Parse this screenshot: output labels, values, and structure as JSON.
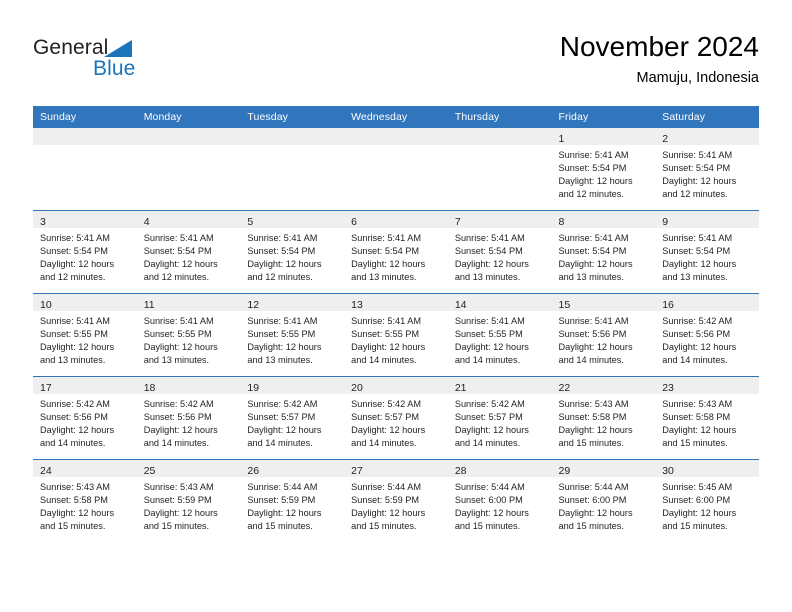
{
  "logo": {
    "word1": "General",
    "word2": "Blue",
    "triangle_color": "#1b75bb",
    "word1_color": "#231f20",
    "word2_color": "#1b75bb"
  },
  "header": {
    "title": "November 2024",
    "subtitle": "Mamuju, Indonesia"
  },
  "theme": {
    "header_blue": "#3175bc",
    "daynum_band": "#efefef",
    "text": "#231f20"
  },
  "weekdays": [
    "Sunday",
    "Monday",
    "Tuesday",
    "Wednesday",
    "Thursday",
    "Friday",
    "Saturday"
  ],
  "weeks": [
    [
      {
        "empty": true
      },
      {
        "empty": true
      },
      {
        "empty": true
      },
      {
        "empty": true
      },
      {
        "empty": true
      },
      {
        "day": "1",
        "l1": "Sunrise: 5:41 AM",
        "l2": "Sunset: 5:54 PM",
        "l3": "Daylight: 12 hours",
        "l4": "and 12 minutes."
      },
      {
        "day": "2",
        "l1": "Sunrise: 5:41 AM",
        "l2": "Sunset: 5:54 PM",
        "l3": "Daylight: 12 hours",
        "l4": "and 12 minutes."
      }
    ],
    [
      {
        "day": "3",
        "l1": "Sunrise: 5:41 AM",
        "l2": "Sunset: 5:54 PM",
        "l3": "Daylight: 12 hours",
        "l4": "and 12 minutes."
      },
      {
        "day": "4",
        "l1": "Sunrise: 5:41 AM",
        "l2": "Sunset: 5:54 PM",
        "l3": "Daylight: 12 hours",
        "l4": "and 12 minutes."
      },
      {
        "day": "5",
        "l1": "Sunrise: 5:41 AM",
        "l2": "Sunset: 5:54 PM",
        "l3": "Daylight: 12 hours",
        "l4": "and 12 minutes."
      },
      {
        "day": "6",
        "l1": "Sunrise: 5:41 AM",
        "l2": "Sunset: 5:54 PM",
        "l3": "Daylight: 12 hours",
        "l4": "and 13 minutes."
      },
      {
        "day": "7",
        "l1": "Sunrise: 5:41 AM",
        "l2": "Sunset: 5:54 PM",
        "l3": "Daylight: 12 hours",
        "l4": "and 13 minutes."
      },
      {
        "day": "8",
        "l1": "Sunrise: 5:41 AM",
        "l2": "Sunset: 5:54 PM",
        "l3": "Daylight: 12 hours",
        "l4": "and 13 minutes."
      },
      {
        "day": "9",
        "l1": "Sunrise: 5:41 AM",
        "l2": "Sunset: 5:54 PM",
        "l3": "Daylight: 12 hours",
        "l4": "and 13 minutes."
      }
    ],
    [
      {
        "day": "10",
        "l1": "Sunrise: 5:41 AM",
        "l2": "Sunset: 5:55 PM",
        "l3": "Daylight: 12 hours",
        "l4": "and 13 minutes."
      },
      {
        "day": "11",
        "l1": "Sunrise: 5:41 AM",
        "l2": "Sunset: 5:55 PM",
        "l3": "Daylight: 12 hours",
        "l4": "and 13 minutes."
      },
      {
        "day": "12",
        "l1": "Sunrise: 5:41 AM",
        "l2": "Sunset: 5:55 PM",
        "l3": "Daylight: 12 hours",
        "l4": "and 13 minutes."
      },
      {
        "day": "13",
        "l1": "Sunrise: 5:41 AM",
        "l2": "Sunset: 5:55 PM",
        "l3": "Daylight: 12 hours",
        "l4": "and 14 minutes."
      },
      {
        "day": "14",
        "l1": "Sunrise: 5:41 AM",
        "l2": "Sunset: 5:55 PM",
        "l3": "Daylight: 12 hours",
        "l4": "and 14 minutes."
      },
      {
        "day": "15",
        "l1": "Sunrise: 5:41 AM",
        "l2": "Sunset: 5:56 PM",
        "l3": "Daylight: 12 hours",
        "l4": "and 14 minutes."
      },
      {
        "day": "16",
        "l1": "Sunrise: 5:42 AM",
        "l2": "Sunset: 5:56 PM",
        "l3": "Daylight: 12 hours",
        "l4": "and 14 minutes."
      }
    ],
    [
      {
        "day": "17",
        "l1": "Sunrise: 5:42 AM",
        "l2": "Sunset: 5:56 PM",
        "l3": "Daylight: 12 hours",
        "l4": "and 14 minutes."
      },
      {
        "day": "18",
        "l1": "Sunrise: 5:42 AM",
        "l2": "Sunset: 5:56 PM",
        "l3": "Daylight: 12 hours",
        "l4": "and 14 minutes."
      },
      {
        "day": "19",
        "l1": "Sunrise: 5:42 AM",
        "l2": "Sunset: 5:57 PM",
        "l3": "Daylight: 12 hours",
        "l4": "and 14 minutes."
      },
      {
        "day": "20",
        "l1": "Sunrise: 5:42 AM",
        "l2": "Sunset: 5:57 PM",
        "l3": "Daylight: 12 hours",
        "l4": "and 14 minutes."
      },
      {
        "day": "21",
        "l1": "Sunrise: 5:42 AM",
        "l2": "Sunset: 5:57 PM",
        "l3": "Daylight: 12 hours",
        "l4": "and 14 minutes."
      },
      {
        "day": "22",
        "l1": "Sunrise: 5:43 AM",
        "l2": "Sunset: 5:58 PM",
        "l3": "Daylight: 12 hours",
        "l4": "and 15 minutes."
      },
      {
        "day": "23",
        "l1": "Sunrise: 5:43 AM",
        "l2": "Sunset: 5:58 PM",
        "l3": "Daylight: 12 hours",
        "l4": "and 15 minutes."
      }
    ],
    [
      {
        "day": "24",
        "l1": "Sunrise: 5:43 AM",
        "l2": "Sunset: 5:58 PM",
        "l3": "Daylight: 12 hours",
        "l4": "and 15 minutes."
      },
      {
        "day": "25",
        "l1": "Sunrise: 5:43 AM",
        "l2": "Sunset: 5:59 PM",
        "l3": "Daylight: 12 hours",
        "l4": "and 15 minutes."
      },
      {
        "day": "26",
        "l1": "Sunrise: 5:44 AM",
        "l2": "Sunset: 5:59 PM",
        "l3": "Daylight: 12 hours",
        "l4": "and 15 minutes."
      },
      {
        "day": "27",
        "l1": "Sunrise: 5:44 AM",
        "l2": "Sunset: 5:59 PM",
        "l3": "Daylight: 12 hours",
        "l4": "and 15 minutes."
      },
      {
        "day": "28",
        "l1": "Sunrise: 5:44 AM",
        "l2": "Sunset: 6:00 PM",
        "l3": "Daylight: 12 hours",
        "l4": "and 15 minutes."
      },
      {
        "day": "29",
        "l1": "Sunrise: 5:44 AM",
        "l2": "Sunset: 6:00 PM",
        "l3": "Daylight: 12 hours",
        "l4": "and 15 minutes."
      },
      {
        "day": "30",
        "l1": "Sunrise: 5:45 AM",
        "l2": "Sunset: 6:00 PM",
        "l3": "Daylight: 12 hours",
        "l4": "and 15 minutes."
      }
    ]
  ]
}
